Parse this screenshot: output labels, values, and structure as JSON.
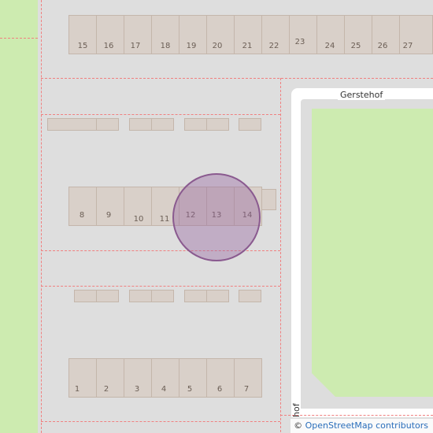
{
  "map": {
    "street_names": {
      "horizontal": "Gerstehof",
      "vertical": "hof"
    },
    "house_numbers": {
      "row_top": [
        "15",
        "16",
        "17",
        "18",
        "19",
        "20",
        "21",
        "22",
        "23",
        "24",
        "25",
        "26",
        "27"
      ],
      "row_middle": [
        "8",
        "9",
        "10",
        "11",
        "12",
        "13",
        "14"
      ],
      "row_bottom": [
        "1",
        "2",
        "3",
        "4",
        "5",
        "6",
        "7"
      ]
    },
    "marker": {
      "label": "location-marker",
      "color": "#8a5a8f"
    },
    "colors": {
      "grass": "#cdebb0",
      "road": "#ffffff",
      "building": "#d9d0c9",
      "boundary": "#f08080"
    }
  },
  "attribution": {
    "symbol": "©",
    "text": "OpenStreetMap contributors"
  }
}
